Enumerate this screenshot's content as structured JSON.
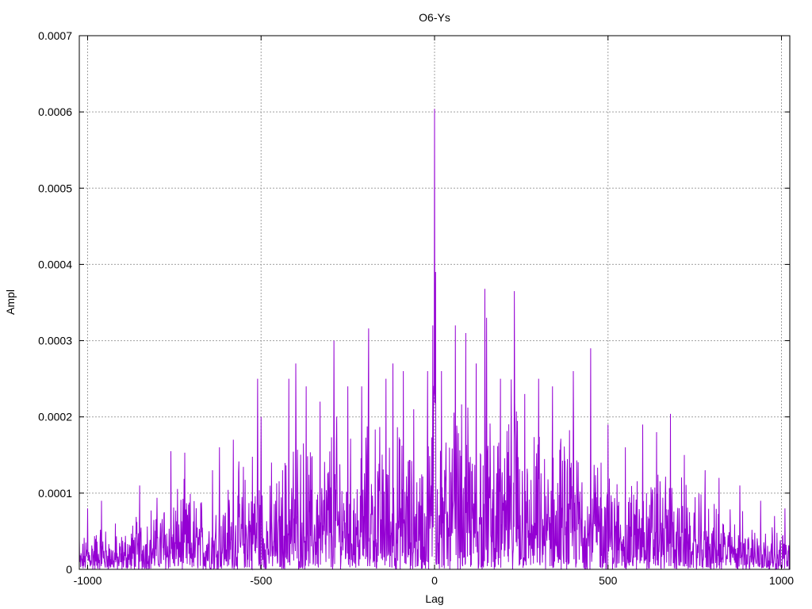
{
  "chart_data": {
    "type": "line",
    "title": "O6-Ys",
    "xlabel": "Lag",
    "ylabel": "Ampl",
    "xlim": [
      -1024,
      1024
    ],
    "ylim": [
      0,
      0.0007
    ],
    "grid": true,
    "x_ticks": [
      -1000,
      -500,
      0,
      500,
      1000
    ],
    "x_tick_labels": [
      "-1000",
      "-500",
      "0",
      "500",
      "1000"
    ],
    "y_ticks": [
      0,
      0.0001,
      0.0002,
      0.0003,
      0.0004,
      0.0005,
      0.0006,
      0.0007
    ],
    "y_tick_labels": [
      "0",
      "0.0001",
      "0.0002",
      "0.0003",
      "0.0004",
      "0.0005",
      "0.0006",
      "0.0007"
    ],
    "series": [
      {
        "color": "#9400d3",
        "peaks": [
          {
            "x": -1024,
            "y": 4e-05
          },
          {
            "x": -1000,
            "y": 8e-05
          },
          {
            "x": -960,
            "y": 9e-05
          },
          {
            "x": -920,
            "y": 6e-05
          },
          {
            "x": -850,
            "y": 0.00011
          },
          {
            "x": -760,
            "y": 0.000155
          },
          {
            "x": -720,
            "y": 0.000153
          },
          {
            "x": -640,
            "y": 0.00013
          },
          {
            "x": -620,
            "y": 0.00016
          },
          {
            "x": -580,
            "y": 0.00017
          },
          {
            "x": -510,
            "y": 0.00025
          },
          {
            "x": -500,
            "y": 0.0002
          },
          {
            "x": -470,
            "y": 0.00014
          },
          {
            "x": -420,
            "y": 0.00025
          },
          {
            "x": -400,
            "y": 0.00027
          },
          {
            "x": -370,
            "y": 0.00024
          },
          {
            "x": -330,
            "y": 0.00022
          },
          {
            "x": -290,
            "y": 0.0003
          },
          {
            "x": -250,
            "y": 0.00024
          },
          {
            "x": -210,
            "y": 0.00024
          },
          {
            "x": -190,
            "y": 0.000316
          },
          {
            "x": -140,
            "y": 0.00025
          },
          {
            "x": -120,
            "y": 0.00027
          },
          {
            "x": -90,
            "y": 0.00026
          },
          {
            "x": -60,
            "y": 0.00021
          },
          {
            "x": -20,
            "y": 0.00026
          },
          {
            "x": -5,
            "y": 0.00032
          },
          {
            "x": 0,
            "y": 0.000604
          },
          {
            "x": 3,
            "y": 0.00039
          },
          {
            "x": 20,
            "y": 0.00026
          },
          {
            "x": 60,
            "y": 0.00032
          },
          {
            "x": 90,
            "y": 0.00031
          },
          {
            "x": 120,
            "y": 0.00027
          },
          {
            "x": 145,
            "y": 0.000368
          },
          {
            "x": 150,
            "y": 0.00033
          },
          {
            "x": 190,
            "y": 0.00025
          },
          {
            "x": 230,
            "y": 0.000365
          },
          {
            "x": 260,
            "y": 0.00023
          },
          {
            "x": 300,
            "y": 0.00025
          },
          {
            "x": 340,
            "y": 0.00024
          },
          {
            "x": 400,
            "y": 0.00026
          },
          {
            "x": 450,
            "y": 0.00029
          },
          {
            "x": 500,
            "y": 0.00019
          },
          {
            "x": 550,
            "y": 0.00016
          },
          {
            "x": 600,
            "y": 0.00019
          },
          {
            "x": 640,
            "y": 0.00018
          },
          {
            "x": 680,
            "y": 0.000204
          },
          {
            "x": 720,
            "y": 0.00015
          },
          {
            "x": 780,
            "y": 0.00013
          },
          {
            "x": 820,
            "y": 0.00012
          },
          {
            "x": 880,
            "y": 0.00011
          },
          {
            "x": 940,
            "y": 9e-05
          },
          {
            "x": 980,
            "y": 7e-05
          },
          {
            "x": 1010,
            "y": 8e-05
          },
          {
            "x": 1024,
            "y": 5e-05
          }
        ]
      }
    ]
  }
}
